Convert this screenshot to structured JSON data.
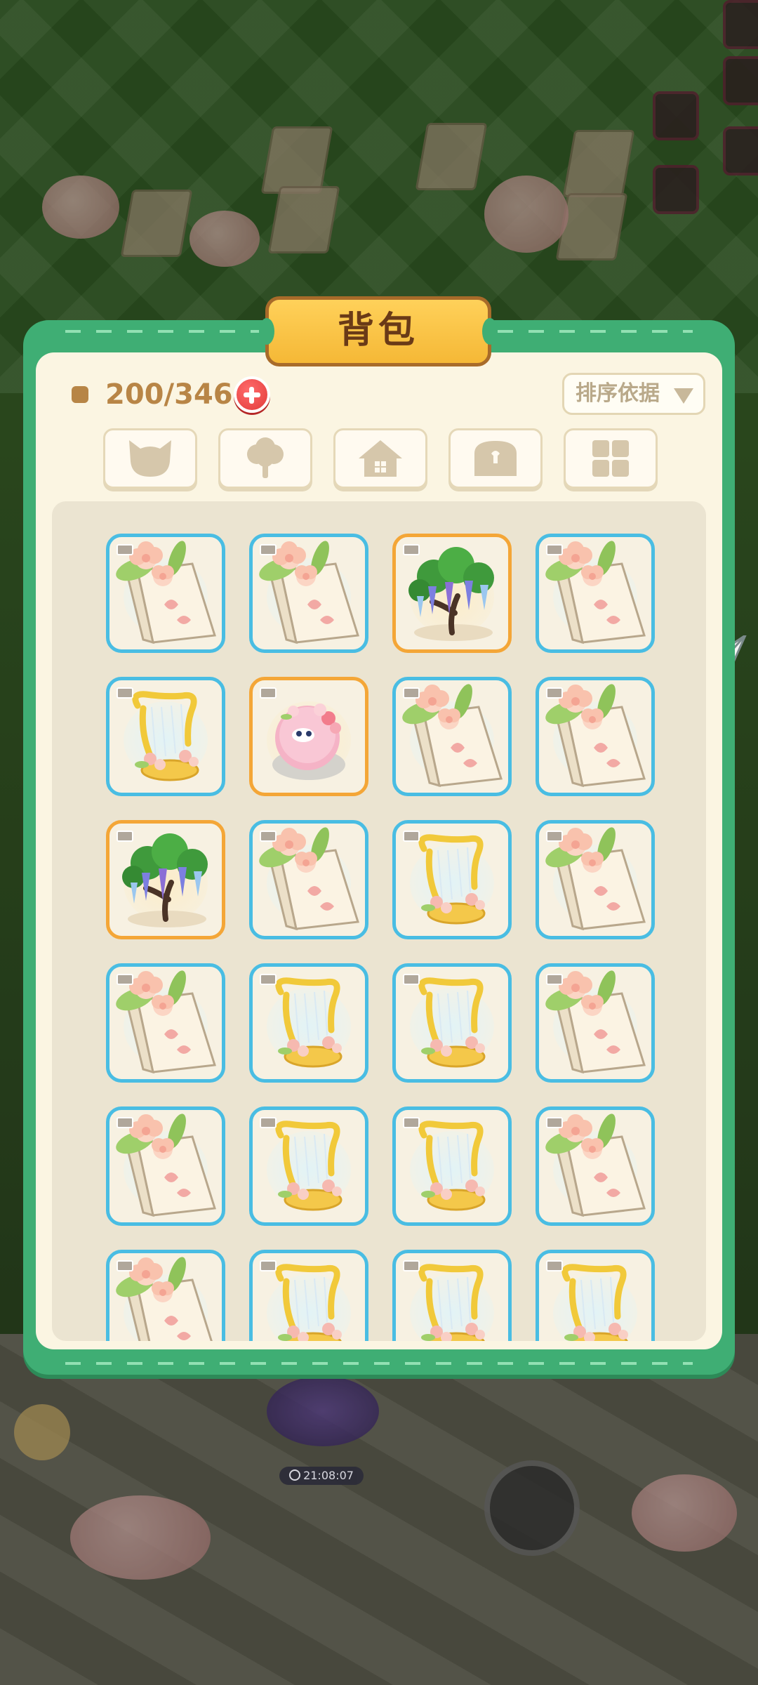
{
  "backpack": {
    "title": "背包",
    "capacity_text": "200/346",
    "sort_label": "排序依据"
  },
  "timer": {
    "text": "21:08:07"
  },
  "category_tabs": [
    {
      "name": "pet",
      "icon": "cat-head-icon"
    },
    {
      "name": "plant",
      "icon": "tree-icon"
    },
    {
      "name": "building",
      "icon": "house-icon"
    },
    {
      "name": "chest",
      "icon": "treasure-chest-icon"
    },
    {
      "name": "all",
      "icon": "grid-squares-icon"
    }
  ],
  "inventory": [
    {
      "item": "blossom-stand-icon",
      "rarity": "blue"
    },
    {
      "item": "blossom-stand-icon",
      "rarity": "blue"
    },
    {
      "item": "wisteria-tree-icon",
      "rarity": "gold"
    },
    {
      "item": "blossom-stand-icon",
      "rarity": "blue"
    },
    {
      "item": "golden-harp-icon",
      "rarity": "blue"
    },
    {
      "item": "pink-bird-icon",
      "rarity": "gold"
    },
    {
      "item": "blossom-stand-icon",
      "rarity": "blue"
    },
    {
      "item": "blossom-stand-icon",
      "rarity": "blue"
    },
    {
      "item": "wisteria-tree-icon",
      "rarity": "gold"
    },
    {
      "item": "blossom-stand-icon",
      "rarity": "blue"
    },
    {
      "item": "golden-harp-icon",
      "rarity": "blue"
    },
    {
      "item": "blossom-stand-icon",
      "rarity": "blue"
    },
    {
      "item": "blossom-stand-icon",
      "rarity": "blue"
    },
    {
      "item": "golden-harp-icon",
      "rarity": "blue"
    },
    {
      "item": "golden-harp-icon",
      "rarity": "blue"
    },
    {
      "item": "blossom-stand-icon",
      "rarity": "blue"
    },
    {
      "item": "blossom-stand-icon",
      "rarity": "blue"
    },
    {
      "item": "golden-harp-icon",
      "rarity": "blue"
    },
    {
      "item": "golden-harp-icon",
      "rarity": "blue"
    },
    {
      "item": "blossom-stand-icon",
      "rarity": "blue"
    },
    {
      "item": "blossom-stand-icon",
      "rarity": "blue"
    },
    {
      "item": "golden-harp-icon",
      "rarity": "blue"
    },
    {
      "item": "golden-harp-icon",
      "rarity": "blue"
    },
    {
      "item": "golden-harp-icon",
      "rarity": "blue"
    }
  ],
  "colors": {
    "panel_green": "#3fae74",
    "slot_blue": "#49bde3",
    "slot_gold": "#f4a637",
    "title_gold": "#f5b836",
    "capacity_brown": "#b88546"
  }
}
